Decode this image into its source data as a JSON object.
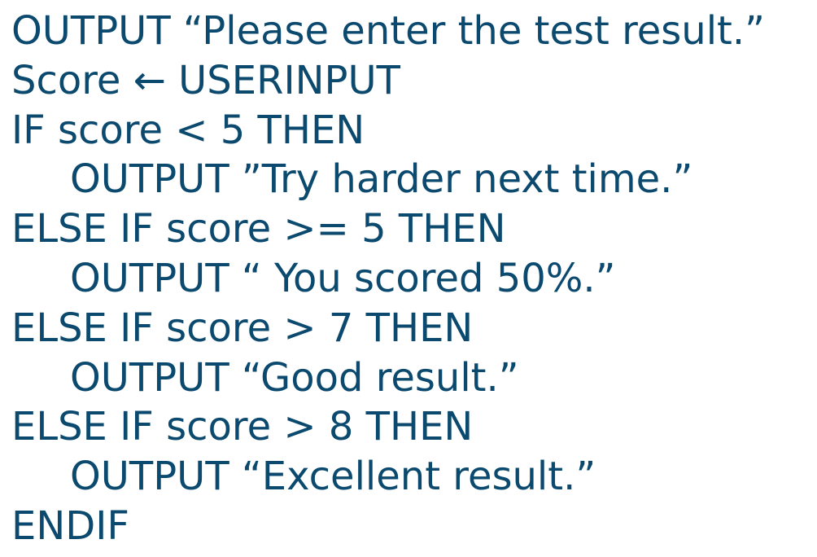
{
  "accent_color": "#0b4a6e",
  "background_color": "#ffffff",
  "code": {
    "lines": [
      {
        "text": "OUTPUT “Please enter the test result.”",
        "indent": 0
      },
      {
        "text": "Score ← USERINPUT",
        "indent": 0
      },
      {
        "text": "IF score < 5 THEN",
        "indent": 0
      },
      {
        "text": "OUTPUT ”Try harder next time.”",
        "indent": 1
      },
      {
        "text": "ELSE IF score >= 5 THEN",
        "indent": 0
      },
      {
        "text": "OUTPUT “ You scored 50%.”",
        "indent": 1
      },
      {
        "text": "ELSE IF score > 7 THEN",
        "indent": 0
      },
      {
        "text": "OUTPUT “Good result.”",
        "indent": 1
      },
      {
        "text": "ELSE IF score > 8 THEN",
        "indent": 0
      },
      {
        "text": "OUTPUT “Excellent result.”",
        "indent": 1
      },
      {
        "text": "ENDIF",
        "indent": 0
      }
    ]
  }
}
